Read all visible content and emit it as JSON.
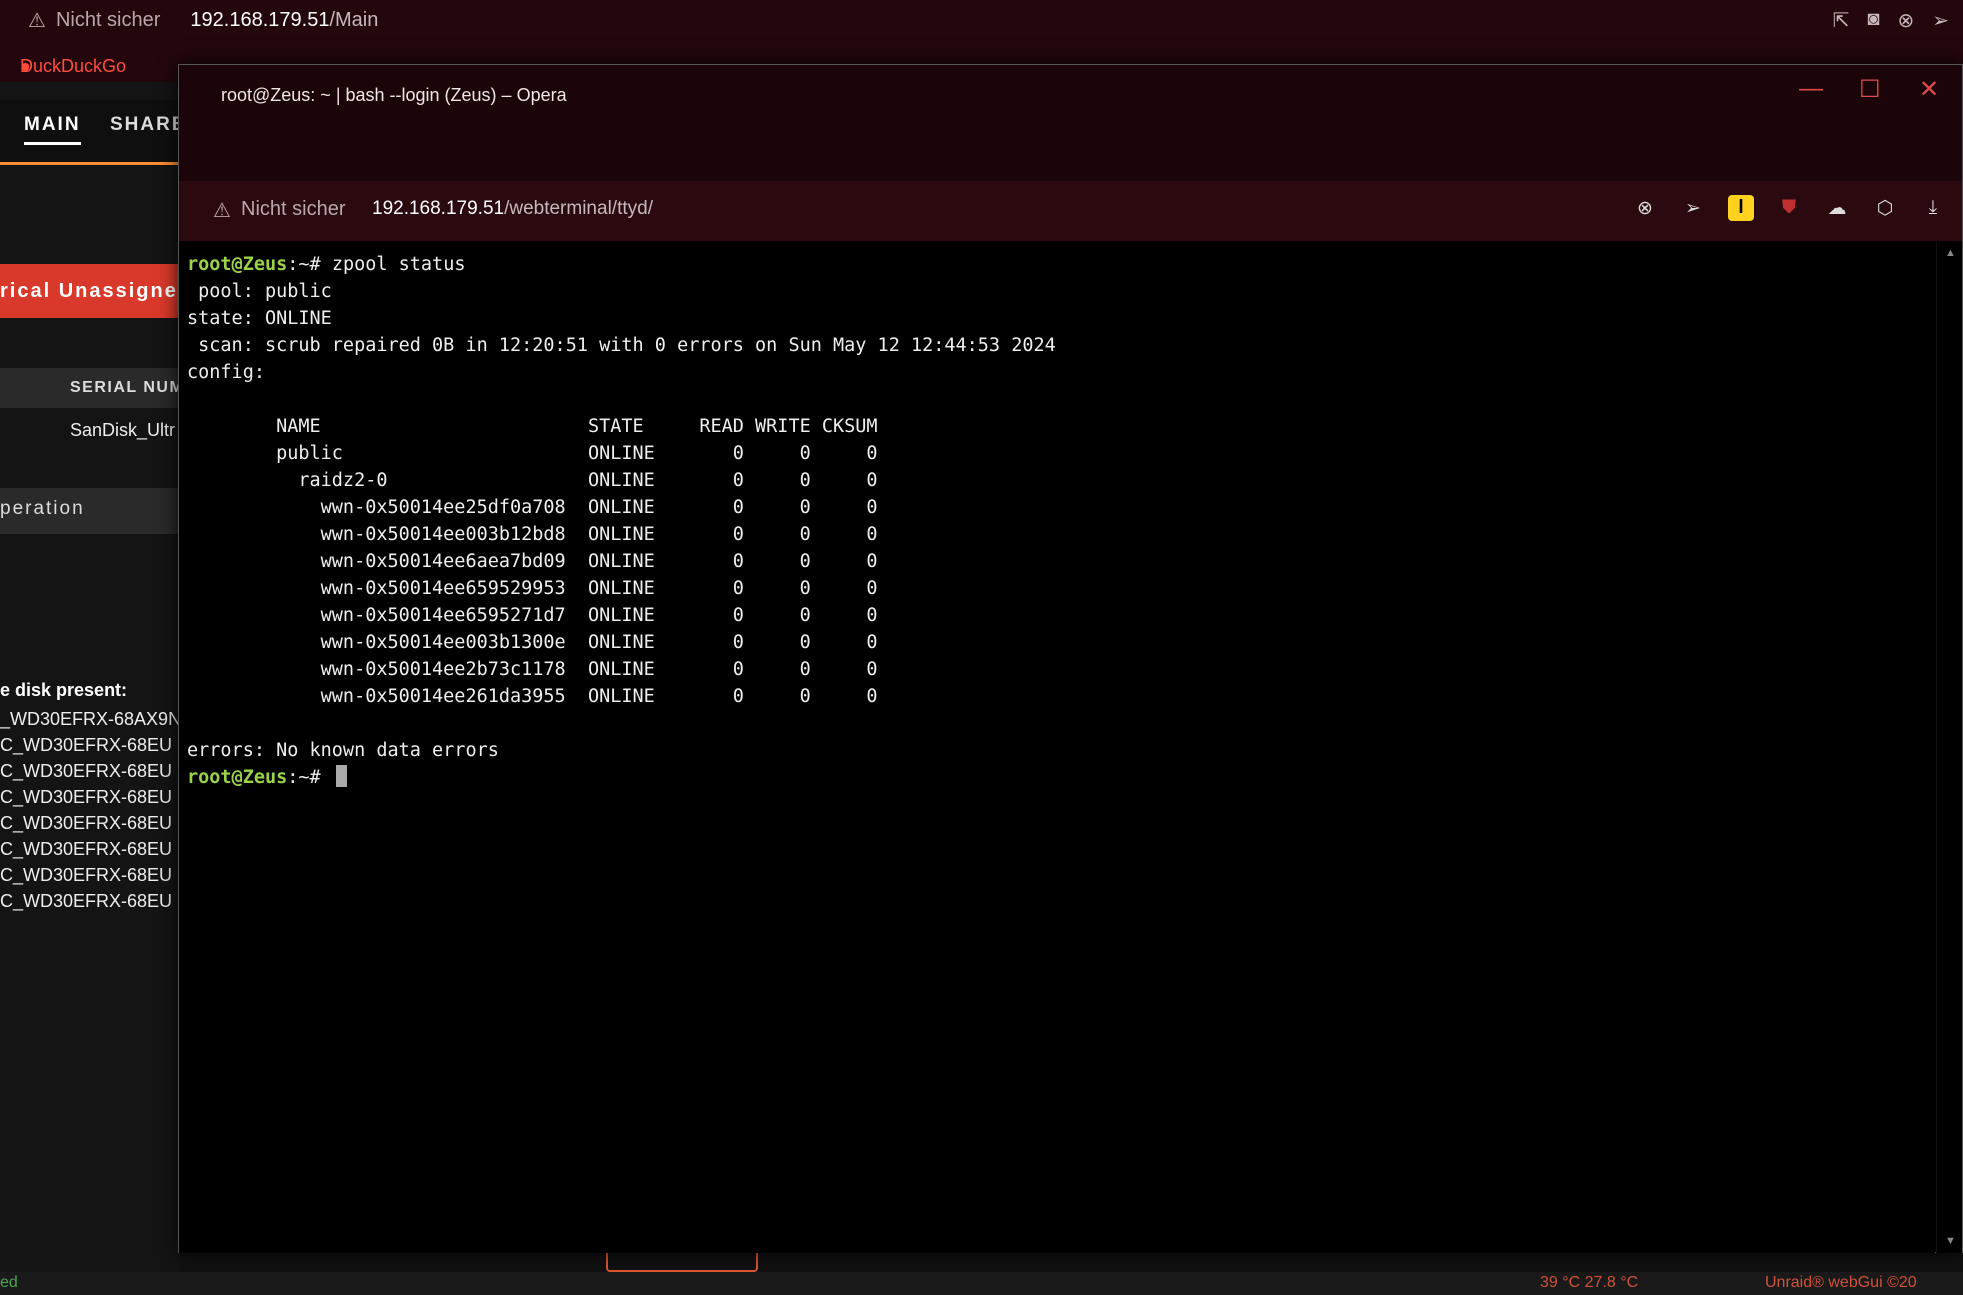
{
  "bg_browser": {
    "url_warning": "Nicht sicher",
    "url_host": "192.168.179.51",
    "url_path": "/Main",
    "bookmarks": [
      "DuckDuckGo"
    ],
    "nav_tabs": [
      "MAIN",
      "SHARE"
    ],
    "historical_bar": "rical Unassigne",
    "serial_header": "SERIAL NUM",
    "serial_value": "SanDisk_Ultr",
    "operation_bar": "peration",
    "disk_present_label": "e disk present:",
    "disk_list": [
      "_WD30EFRX-68AX9N",
      "C_WD30EFRX-68EU",
      "C_WD30EFRX-68EU",
      "C_WD30EFRX-68EU",
      "C_WD30EFRX-68EU",
      "C_WD30EFRX-68EU",
      "C_WD30EFRX-68EU",
      "C_WD30EFRX-68EU"
    ],
    "status_left": "ed",
    "status_temps": "39 °C   27.8 °C",
    "status_brand": "Unraid® webGui ©20"
  },
  "window": {
    "title": "root@Zeus: ~ | bash --login (Zeus) – Opera",
    "minimize": "—",
    "maximize": "☐",
    "close": "✕",
    "url_warning": "Nicht sicher",
    "url_host": "192.168.179.51",
    "url_path": "/webterminal/ttyd/"
  },
  "terminal": {
    "prompt_user": "root@Zeus",
    "prompt_suffix": ":~# ",
    "command": "zpool status",
    "lines": [
      " pool: public",
      "state: ONLINE",
      " scan: scrub repaired 0B in 12:20:51 with 0 errors on Sun May 12 12:44:53 2024",
      "config:",
      "",
      "        NAME                        STATE     READ WRITE CKSUM",
      "        public                      ONLINE       0     0     0",
      "          raidz2-0                  ONLINE       0     0     0",
      "            wwn-0x50014ee25df0a708  ONLINE       0     0     0",
      "            wwn-0x50014ee003b12bd8  ONLINE       0     0     0",
      "            wwn-0x50014ee6aea7bd09  ONLINE       0     0     0",
      "            wwn-0x50014ee659529953  ONLINE       0     0     0",
      "            wwn-0x50014ee6595271d7  ONLINE       0     0     0",
      "            wwn-0x50014ee003b1300e  ONLINE       0     0     0",
      "            wwn-0x50014ee2b73c1178  ONLINE       0     0     0",
      "            wwn-0x50014ee261da3955  ONLINE       0     0     0",
      "",
      "errors: No known data errors"
    ]
  }
}
